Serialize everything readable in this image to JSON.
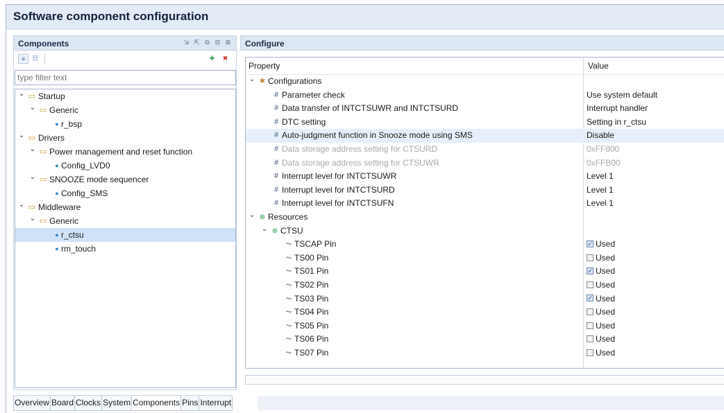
{
  "window": {
    "title": "Software component configuration"
  },
  "components_panel": {
    "title": "Components",
    "filter_placeholder": "type filter text",
    "header_icons": [
      "import-icon",
      "export-icon",
      "copy-icon",
      "collapse-icon",
      "expand-icon"
    ],
    "toolbar_left": [
      "show-by-category-icon",
      "show-flat-icon"
    ],
    "toolbar_right": [
      "add-component-icon",
      "remove-component-icon"
    ],
    "tree": [
      {
        "label": "Startup",
        "level": 0,
        "type": "folder",
        "expanded": true
      },
      {
        "label": "Generic",
        "level": 1,
        "type": "folder",
        "expanded": true
      },
      {
        "label": "r_bsp",
        "level": 2,
        "type": "component"
      },
      {
        "label": "Drivers",
        "level": 0,
        "type": "folder",
        "expanded": true
      },
      {
        "label": "Power management and reset function",
        "level": 1,
        "type": "folder",
        "expanded": true
      },
      {
        "label": "Config_LVD0",
        "level": 2,
        "type": "component"
      },
      {
        "label": "SNOOZE mode sequencer",
        "level": 1,
        "type": "folder",
        "expanded": true
      },
      {
        "label": "Config_SMS",
        "level": 2,
        "type": "component"
      },
      {
        "label": "Middleware",
        "level": 0,
        "type": "folder",
        "expanded": true
      },
      {
        "label": "Generic",
        "level": 1,
        "type": "folder",
        "expanded": true
      },
      {
        "label": "r_ctsu",
        "level": 2,
        "type": "component",
        "selected": true
      },
      {
        "label": "rm_touch",
        "level": 2,
        "type": "component"
      }
    ]
  },
  "configure_panel": {
    "title": "Configure",
    "columns": {
      "property": "Property",
      "value": "Value"
    },
    "rows": [
      {
        "label": "Configurations",
        "level": 0,
        "kind": "group-config",
        "value": ""
      },
      {
        "label": "Parameter check",
        "level": 1,
        "kind": "param",
        "value": "Use system default"
      },
      {
        "label": "Data transfer of INTCTSUWR and INTCTSURD",
        "level": 1,
        "kind": "param",
        "value": "Interrupt handler"
      },
      {
        "label": "DTC setting",
        "level": 1,
        "kind": "param",
        "value": "Setting in r_ctsu"
      },
      {
        "label": "Auto-judgment function in Snooze mode using SMS",
        "level": 1,
        "kind": "param",
        "value": "Disable",
        "highlight": true
      },
      {
        "label": "Data storage address setting for CTSURD",
        "level": 1,
        "kind": "param",
        "value": "0xFF800",
        "disabled": true
      },
      {
        "label": "Data storage address setting for CTSUWR",
        "level": 1,
        "kind": "param",
        "value": "0xFFB00",
        "disabled": true
      },
      {
        "label": "Interrupt level for INTCTSUWR",
        "level": 1,
        "kind": "param",
        "value": "Level 1"
      },
      {
        "label": "Interrupt level for INTCTSURD",
        "level": 1,
        "kind": "param",
        "value": "Level 1"
      },
      {
        "label": "Interrupt level for INTCTSUFN",
        "level": 1,
        "kind": "param",
        "value": "Level 1"
      },
      {
        "label": "Resources",
        "level": 0,
        "kind": "group-res",
        "value": ""
      },
      {
        "label": "CTSU",
        "level": 1,
        "kind": "group-res",
        "value": ""
      },
      {
        "label": "TSCAP Pin",
        "level": 2,
        "kind": "pin",
        "value": "Used",
        "checked": true
      },
      {
        "label": "TS00 Pin",
        "level": 2,
        "kind": "pin",
        "value": "Used",
        "checked": false
      },
      {
        "label": "TS01 Pin",
        "level": 2,
        "kind": "pin",
        "value": "Used",
        "checked": true
      },
      {
        "label": "TS02 Pin",
        "level": 2,
        "kind": "pin",
        "value": "Used",
        "checked": false
      },
      {
        "label": "TS03 Pin",
        "level": 2,
        "kind": "pin",
        "value": "Used",
        "checked": true
      },
      {
        "label": "TS04 Pin",
        "level": 2,
        "kind": "pin",
        "value": "Used",
        "checked": false
      },
      {
        "label": "TS05 Pin",
        "level": 2,
        "kind": "pin",
        "value": "Used",
        "checked": false
      },
      {
        "label": "TS06 Pin",
        "level": 2,
        "kind": "pin",
        "value": "Used",
        "checked": false
      },
      {
        "label": "TS07 Pin",
        "level": 2,
        "kind": "pin",
        "value": "Used",
        "checked": false
      }
    ]
  },
  "tabs": [
    {
      "label": "Overview",
      "active": false
    },
    {
      "label": "Board",
      "active": false
    },
    {
      "label": "Clocks",
      "active": false
    },
    {
      "label": "System",
      "active": false
    },
    {
      "label": "Components",
      "active": true
    },
    {
      "label": "Pins",
      "active": false
    },
    {
      "label": "Interrupt",
      "active": false
    }
  ]
}
